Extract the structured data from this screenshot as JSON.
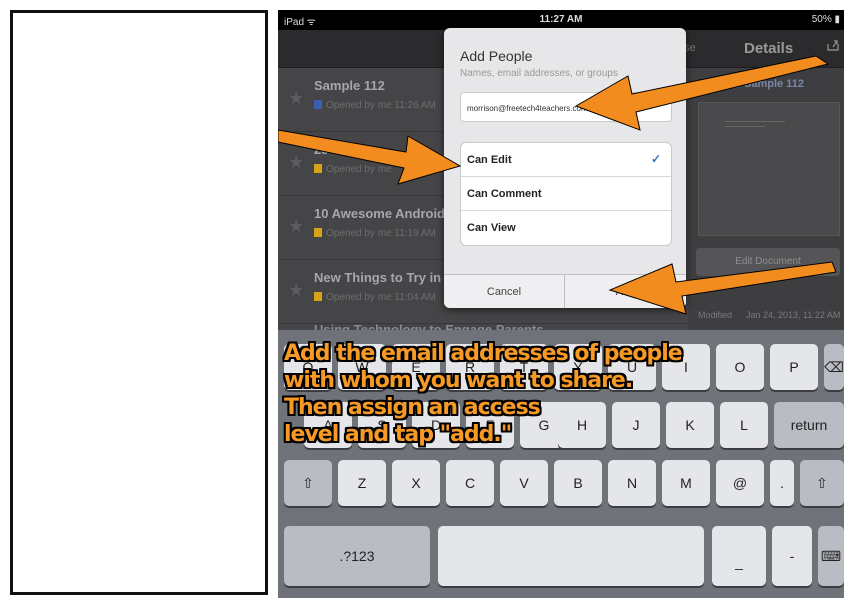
{
  "status_bar": {
    "carrier": "iPad ᯤ",
    "time": "11:27 AM",
    "battery": "50% ▮"
  },
  "nav": {
    "left_fragment": "se",
    "details_title": "Details",
    "share_icon": "share-icon"
  },
  "doc_list": [
    {
      "title": "Sample 112",
      "meta": "Opened by me 11:26 AM",
      "icon_color": "#3a5fb0"
    },
    {
      "title": "25 E",
      "meta": "Opened by me",
      "icon_color": "#d6a21a"
    },
    {
      "title": "10 Awesome Android Use",
      "meta": "Opened by me 11:19 AM",
      "icon_color": "#d6a21a"
    },
    {
      "title": "New Things to Try in the",
      "meta": "Opened by me 11:04 AM",
      "icon_color": "#d6a21a"
    }
  ],
  "doc_list_partial": "Using Technology to Engage Parents",
  "details": {
    "doc_name": "Sample 112",
    "edit_button": "Edit Document",
    "modified_label": "Modified",
    "modified_value": "Jan 24, 2013, 11:22 AM"
  },
  "popover": {
    "title": "Add People",
    "subtitle": "Names, email addresses, or groups",
    "email_value": "morrison@freetech4teachers.com",
    "options": [
      {
        "label": "Can Edit",
        "selected": true
      },
      {
        "label": "Can Comment",
        "selected": false
      },
      {
        "label": "Can View",
        "selected": false
      }
    ],
    "check_icon": "✓",
    "cancel_label": "Cancel",
    "add_label": "Add"
  },
  "keyboard": {
    "row1": [
      "Q",
      "W",
      "E",
      "R",
      "T",
      "Y",
      "U",
      "I",
      "O",
      "P"
    ],
    "backspace_icon": "⌫",
    "row2": [
      "A",
      "S",
      "D",
      "F",
      "G",
      "H",
      "J",
      "K",
      "L"
    ],
    "return_label": "return",
    "row3": [
      "Z",
      "X",
      "C",
      "V",
      "B",
      "N",
      "M",
      "@",
      "."
    ],
    "shift_icon": "⇧",
    "numbers_label": ".?123",
    "underscore_label": "_",
    "dash_label": "-",
    "hide_keyboard_icon": "⌨"
  },
  "caption": {
    "line1": "Add the email addresses of people",
    "line2": "with whom you want to share.",
    "line3": "Then assign an access",
    "line4": "level and tap \"add.\""
  },
  "colors": {
    "arrow": "#f28c1f",
    "caption_fill": "#f79a25",
    "check": "#3b6fc2"
  }
}
